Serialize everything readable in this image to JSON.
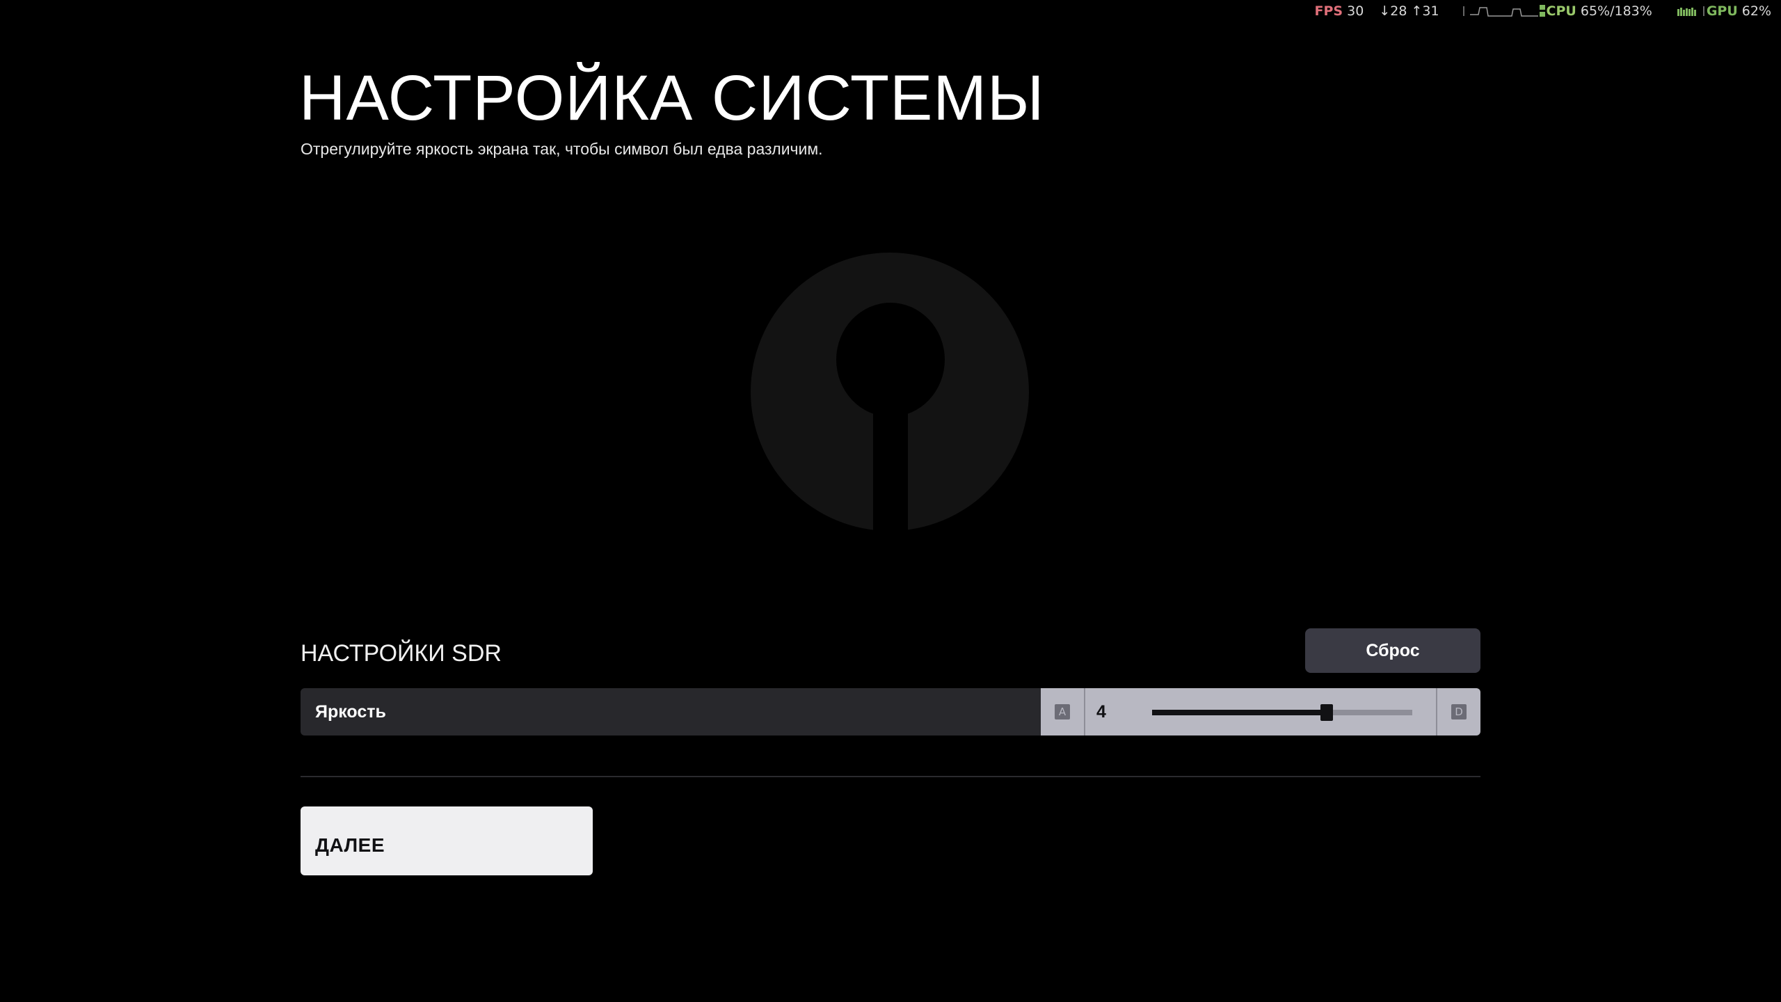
{
  "overlay": {
    "fps_label": "FPS",
    "fps_value": "30",
    "frametime": "↓28 ↑31",
    "cpu_label": "CPU",
    "cpu_value": "65%/183%",
    "gpu_label": "GPU",
    "gpu_value": "62%",
    "accent_fps": "#e0707a",
    "accent_cpu": "#9ac96b",
    "accent_gpu": "#7fb85e"
  },
  "header": {
    "title": "НАСТРОЙКА СИСТЕМЫ",
    "subtitle": "Отрегулируйте яркость экрана так, чтобы символ был едва различим."
  },
  "symbol": {
    "icon": "calibration-logo-icon",
    "color": "#131313"
  },
  "sdr": {
    "section_title": "НАСТРОЙКИ SDR",
    "reset_label": "Сброс",
    "brightness": {
      "label": "Яркость",
      "value": "4",
      "fraction": 0.67,
      "decrease_key": "A",
      "increase_key": "D"
    }
  },
  "footer": {
    "next_label": "ДАЛЕЕ"
  }
}
